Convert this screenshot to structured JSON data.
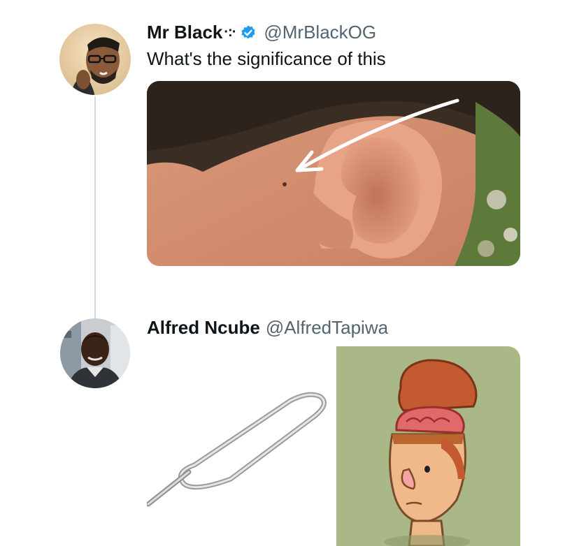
{
  "tweets": [
    {
      "author": {
        "name": "Mr Black",
        "name_emoji": "·:·",
        "verified": true,
        "handle": "@MrBlackOG",
        "avatar": "avatar-photo-man-glasses"
      },
      "text": "What's the significance of this",
      "media": [
        {
          "type": "photo",
          "subject": "ear-with-arrow-pointing-to-pit"
        }
      ]
    },
    {
      "author": {
        "name": "Alfred Ncube",
        "handle": "@AlfredTapiwa",
        "avatar": "avatar-photo-man"
      },
      "media": [
        {
          "type": "photo",
          "subject": "sim-ejector-pin"
        },
        {
          "type": "illustration",
          "subject": "open-head-brain-cartoon"
        }
      ]
    }
  ],
  "colors": {
    "text": "#0f1419",
    "handle": "#536471",
    "verified_badge": "#1d9bf0",
    "thread_line": "#cfd9de",
    "cartoon_bg": "#a9b886"
  }
}
